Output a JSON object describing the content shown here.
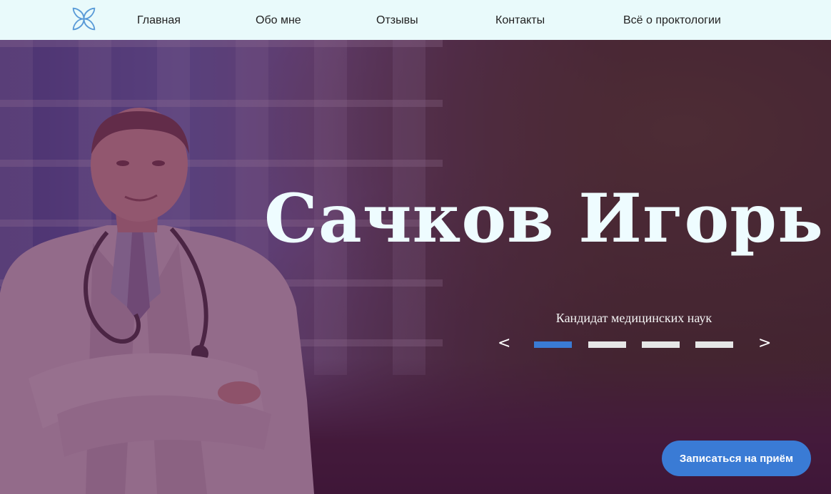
{
  "nav": {
    "items": [
      {
        "label": "Главная"
      },
      {
        "label": "Обо мне"
      },
      {
        "label": "Отзывы"
      },
      {
        "label": "Контакты"
      },
      {
        "label": "Всё о проктологии"
      }
    ]
  },
  "hero": {
    "title": "Сачков Игорь",
    "subtitle": "Кандидат медицинских наук",
    "prev": "<",
    "next": ">",
    "slides_total": 4,
    "active_slide": 1,
    "cta_label": "Записаться на приём"
  },
  "colors": {
    "accent": "#3a7bd5",
    "nav_bg": "#e9fafb",
    "hero_tint": "#5a1446"
  },
  "icons": {
    "logo": "four-petal-logo-icon"
  }
}
